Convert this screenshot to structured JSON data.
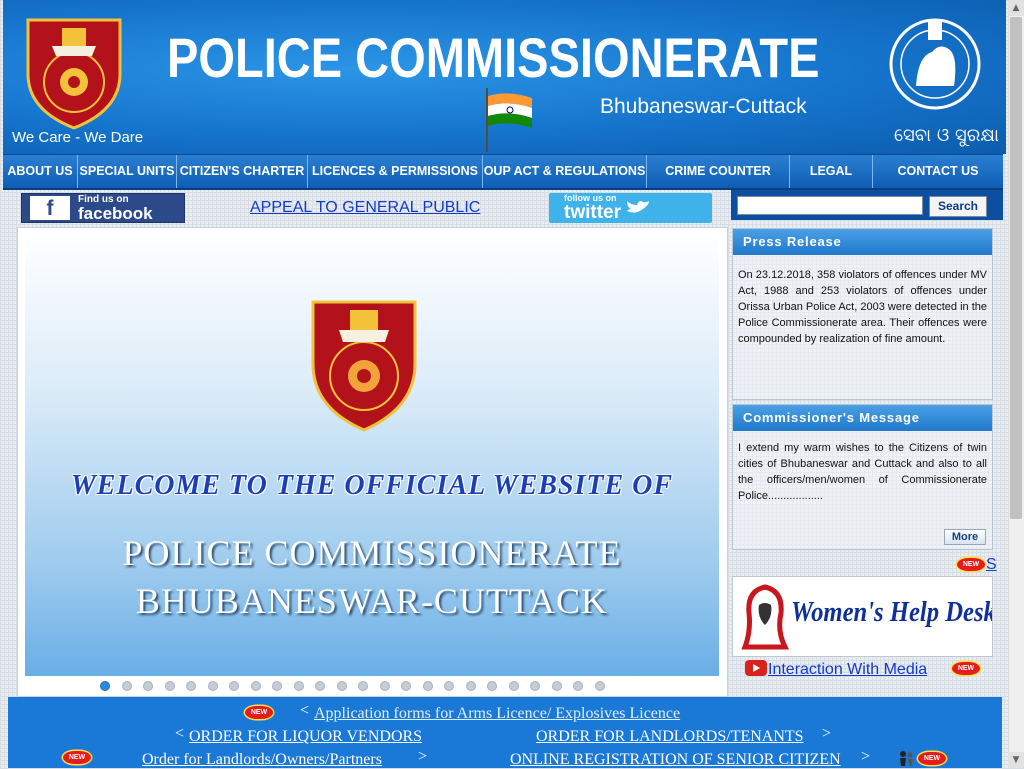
{
  "header": {
    "tagline": "We Care - We Dare",
    "title": "POLICE COMMISSIONERATE",
    "subtitle": "Bhubaneswar-Cuttack",
    "odia_motto": "ସେବା ଓ ସୁରକ୍ଷା"
  },
  "nav": {
    "items": [
      {
        "label": "ABOUT US"
      },
      {
        "label": "SPECIAL UNITS"
      },
      {
        "label": "CITIZEN'S CHARTER"
      },
      {
        "label": "LICENCES & PERMISSIONS"
      },
      {
        "label": "OUP ACT & REGULATIONS"
      },
      {
        "label": "CRIME COUNTER"
      },
      {
        "label": "LEGAL"
      },
      {
        "label": "CONTACT US"
      }
    ]
  },
  "social": {
    "facebook_line1": "Find us on",
    "facebook_line2": "facebook",
    "twitter_line1": "follow us on",
    "twitter_line2": "twitter"
  },
  "appeal_link": "APPEAL TO GENERAL PUBLIC",
  "slider": {
    "welcome": "WELCOME TO THE OFFICIAL WEBSITE OF",
    "line1": "POLICE COMMISSIONERATE",
    "line2": "BHUBANESWAR-CUTTACK",
    "dot_count": 24,
    "active_dot": 1
  },
  "search": {
    "button_label": "Search",
    "value": ""
  },
  "press_release": {
    "heading": "Press Release",
    "text": "On 23.12.2018, 358 violators of offences under MV Act, 1988 and 253 violators of offences under Orissa Urban Police Act, 2003 were detected in the Police Commissionerate area. Their offences were compounded by realization of fine amount."
  },
  "commissioner": {
    "heading": "Commissioner's Message",
    "text": "I extend my warm wishes to the Citizens of twin cities of Bhubaneswar and Cuttack and also to all the officers/men/women of Commissionerate Police..................",
    "more_label": "More"
  },
  "badges": {
    "new": "NEW"
  },
  "marquee_fragment": "S",
  "womens_help_desk": "Women's Help Desk",
  "media_link": "Interaction With Media",
  "bottom_links": {
    "arms": "Application forms for Arms Licence/ Explosives Licence",
    "liquor": "ORDER FOR LIQUOR VENDORS",
    "landlords_tenants": "ORDER FOR LANDLORDS/TENANTS",
    "landlords_owners": "Order for Landlords/Owners/Partners",
    "senior_citizen": "ONLINE REGISTRATION OF SENIOR CITIZEN",
    "chevron_left": "<",
    "chevron_right": ">"
  },
  "colors": {
    "header_blue": "#1574cc",
    "link_blue": "#1438c8",
    "badge_red": "#e61b1b"
  }
}
